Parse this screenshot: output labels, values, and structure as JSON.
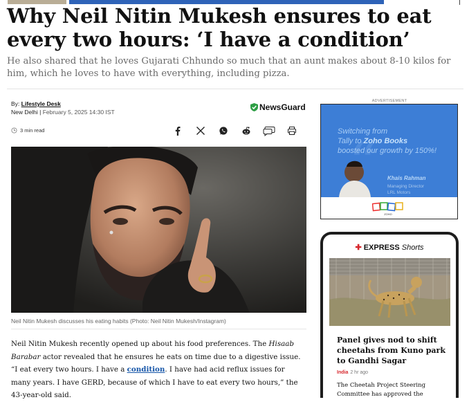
{
  "article": {
    "headline_line1": "Why Neil Nitin Mukesh ensures to eat",
    "headline_line2": "every two hours: ‘I have a condition’",
    "synopsis": "He also shared that he loves Gujarati Chhundo so much that an aunt makes about 8-10 kilos for him, which he loves to have with everything, including pizza.",
    "byline_prefix": "By: ",
    "author": "Lifestyle Desk",
    "location": "New Delhi",
    "separator": " | ",
    "date": "February 5, 2025 14:30 IST",
    "newsguard": "NewsGuard",
    "read_time": "3 min read",
    "image_caption": "Neil Nitin Mukesh discusses his eating habits (Photo: Neil Nitin Mukesh/Instagram)",
    "body": {
      "p1_a": "Neil Nitin Mukesh recently opened up about his food preferences. The ",
      "p1_em": "Hisaab Barabar",
      "p1_b": " actor revealed that he ensures he eats on time due to a digestive issue. “I eat every two hours. I have a ",
      "p1_link": "condition",
      "p1_c": ". I have had acid reflux issues for many years. I have GERD, because of which I have to eat every two hours,” the 43-year-old said."
    }
  },
  "share_icons": [
    "facebook-icon",
    "x-icon",
    "whatsapp-icon",
    "reddit-icon",
    "comment-icon",
    "print-icon"
  ],
  "ad": {
    "label": "ADVERTISEMENT",
    "line1": "Switching from",
    "line2_a": "Tally to ",
    "line2_b": "Zoho Books",
    "line3": "boosted our growth by 150%!",
    "person_name": "Khais Rahman",
    "person_role1": "Managing Director",
    "person_role2": "LRL Motors",
    "brand": "ZOHO",
    "colors": {
      "bg": "#3d7ed6"
    }
  },
  "shorts": {
    "brand_express": "EXPRESS",
    "brand_shorts": "Shorts",
    "headline": "Panel gives nod to shift cheetahs from Kuno park to Gandhi Sagar",
    "category": "India",
    "time": "2 hr ago",
    "summary": "The Cheetah Project Steering Committee has approved the"
  },
  "colors": {
    "accent_red": "#d6262c",
    "link_blue": "#1555a8"
  }
}
